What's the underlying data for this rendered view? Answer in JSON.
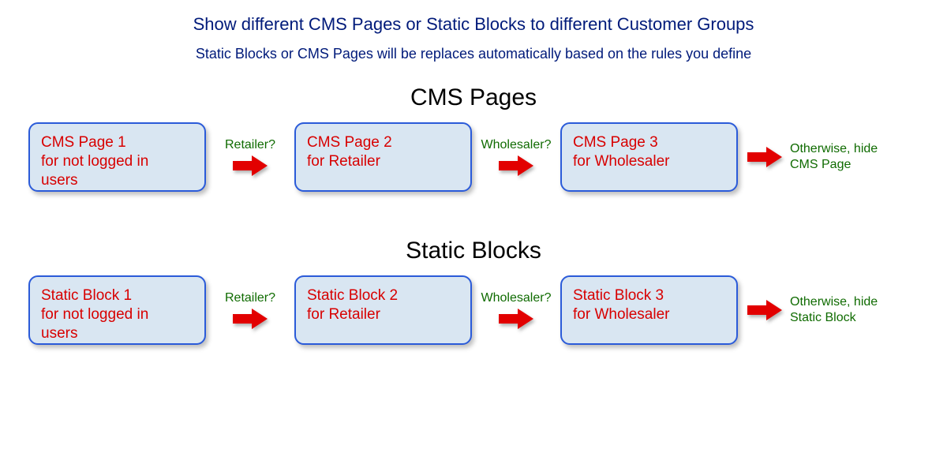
{
  "title": "Show different CMS Pages or Static Blocks to different Customer Groups",
  "subtitle": "Static Blocks or CMS Pages will be replaces automatically based on the rules you define",
  "sections": {
    "cms": {
      "heading": "CMS Pages",
      "box1": "CMS Page 1\nfor not logged in\nusers",
      "connector1": "Retailer?",
      "box2": "CMS Page 2\nfor Retailer",
      "connector2": "Wholesaler?",
      "box3": "CMS Page 3\nfor Wholesaler",
      "end_note": "Otherwise, hide\nCMS Page"
    },
    "static": {
      "heading": "Static Blocks",
      "box1": "Static Block 1\nfor not logged in\nusers",
      "connector1": "Retailer?",
      "box2": "Static Block 2\nfor Retailer",
      "connector2": "Wholesaler?",
      "box3": "Static Block 3\nfor Wholesaler",
      "end_note": "Otherwise, hide\nStatic Block"
    }
  }
}
